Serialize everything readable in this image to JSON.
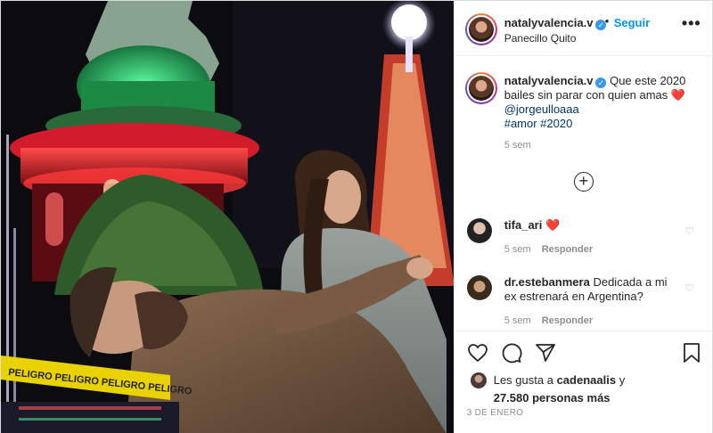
{
  "post": {
    "username": "natalyvalencia.v",
    "verified_mark": "✓",
    "follow_label": "Seguir",
    "location": "Panecillo Quito",
    "more_label": "•••"
  },
  "caption": {
    "username": "natalyvalencia.v",
    "text": "Que este 2020 bailes sin parar con quien amas",
    "emoji": "❤️",
    "mention": "@jorgeulloaaa",
    "hashtags": "#amor #2020",
    "time": "5 sem"
  },
  "load_more_label": "+",
  "comments": [
    {
      "username": "tifa_ari",
      "text": "❤️",
      "time": "5 sem",
      "reply_label": "Responder"
    },
    {
      "username": "dr.estebanmera",
      "text": "Dedicada a mi ex estrenará en Argentina?",
      "time": "5 sem",
      "reply_label": "Responder"
    }
  ],
  "likes": {
    "prefix": "Les gusta a",
    "first_user": "cadenaalis",
    "connector": "y",
    "others": "27.580 personas más"
  },
  "date": "3 DE ENERO",
  "photo_text": {
    "tape": "PELIGRO  PELIGRO  PELIGRO  PELIGRO"
  },
  "colors": {
    "accent": "#0095f6",
    "heart": "#ed4956",
    "verified": "#3897f0",
    "muted": "#8e8e8e"
  },
  "icons": [
    "heart-icon",
    "comment-icon",
    "share-icon",
    "bookmark-icon",
    "more-options-icon",
    "add-comments-icon",
    "verified-icon"
  ]
}
